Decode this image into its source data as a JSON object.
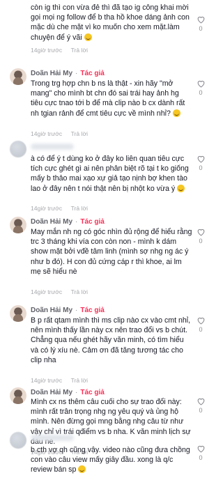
{
  "ui": {
    "reply_label": "Trả lời",
    "author_tag": "Tác giả",
    "dot": "·",
    "heart_icon": "heart-outline-icon",
    "smile_icon": "smile-emoji-icon"
  },
  "comments": [
    {
      "author": "",
      "is_author": false,
      "text": "còn ig thì con vừa đẻ thì đã tạo ig công khai mời gọi mọi ng follow để b tha hồ khoe dáng ảnh con mặc dù che mặt vì ko muốn cho xem mặt.làm chuyện để ý vãi",
      "emoji_end": true,
      "time": "14giờ trước",
      "likes": "0"
    },
    {
      "author": "Doãn Hải My",
      "is_author": true,
      "text": "Trong trg hợp chn b ns là thật - xin hãy \"mở mang\" cho mình bt chn đó sai trái hay ảnh hg tiêu cực tnao tới b để mà clip nào b cx dành rất nh tgian rảnh để cmt tiêu cực về mình nhỉ?",
      "emoji_end": true,
      "time": "14giờ trước",
      "likes": "0"
    },
    {
      "author": "",
      "is_author": false,
      "text": "à có để ý t dùng ko ở đây ko liên quan tiêu cực tích cực ghét gì ai nên phân biệt rõ tại t ko giống mấy b thảo mai xạo xự giả tạo nịnh bợ khen tào lao ở đây nên t nói thật nên bị nhột ko vừa ý",
      "emoji_end": true,
      "time": "14giờ trước",
      "likes": "0"
    },
    {
      "author": "Doãn Hải My",
      "is_author": true,
      "text": "May mắn nh ng có góc nhìn đủ rộng để hiểu rằng trc 3 tháng khi vía con còn non - mình k dám show mặt bởi vđề tâm linh (mình sợ nhg ng ác ý như b đó). H con đủ cứng cáp r thì khoe, ai lm mẹ sẽ hiểu nè",
      "emoji_end": false,
      "time": "14giờ trước",
      "likes": "0"
    },
    {
      "author": "Doãn Hải My",
      "is_author": true,
      "text": "B p rất qtam mình thì ms clip nào cx vào cmt nhỉ, nên mình thấy lần này cx nên trao đổi vs b chút. Chẳng qua nếu ghét hãy văn minh, có tìm hiểu và có lý xíu nè. Cảm ơn đã tăng tương tác cho clip nha",
      "emoji_end": false,
      "time": "14giờ trước",
      "likes": "0"
    },
    {
      "author": "Doãn Hải My",
      "is_author": true,
      "text": "Mình cx ns thêm câu cuối cho sự trao đổi này: mình rất trân trọng nhg ng yêu quý và ủng hộ mình. Nên đừng gọi mng bằng nhg câu từ như vậy chỉ vì trái qđiểm vs b nha. K văn minh lịch sự đâu nè.",
      "emoji_end": false,
      "time": "14giờ trước",
      "likes": "0"
    },
    {
      "author": "",
      "is_author": false,
      "text": "b cth vợ qh cũng vậy. video nào cũng đưa chồng con vào câu view mấy giây đầu. xong là q/c review bán sp",
      "emoji_end": true,
      "time": "",
      "likes": "0"
    }
  ]
}
